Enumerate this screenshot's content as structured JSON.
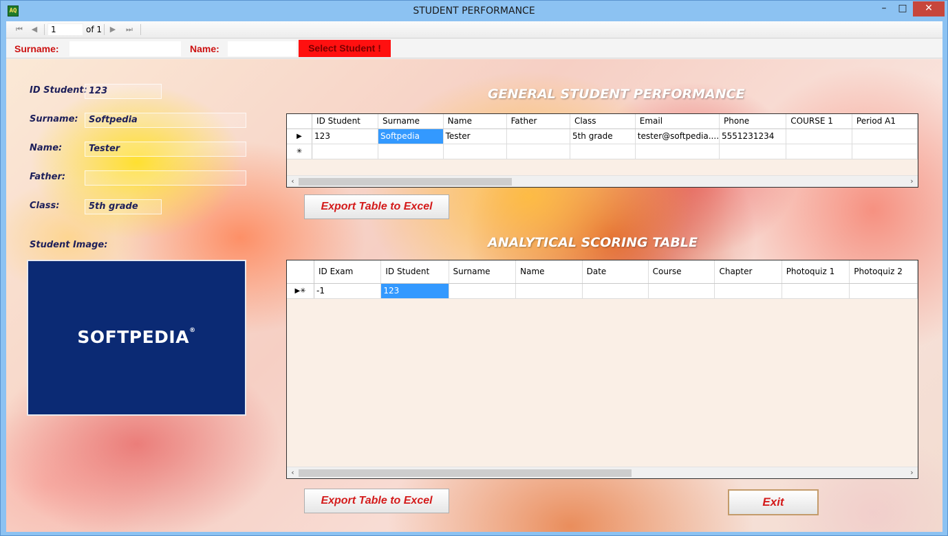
{
  "window": {
    "title": "STUDENT PERFORMANCE",
    "icon": "app-icon",
    "icon_glyph": "AQ",
    "controls": {
      "minimize": "–",
      "maximize": "□",
      "close": "✕"
    }
  },
  "navigator": {
    "position": "1",
    "of_label": "of 1",
    "first_icon": "⏮",
    "prev_icon": "◀",
    "next_icon": "▶",
    "last_icon": "⏭"
  },
  "filter": {
    "surname_label": "Surname:",
    "surname_value": "",
    "name_label": "Name:",
    "name_value": "",
    "select_button": "Select Student !"
  },
  "student": {
    "id_label": "ID Student:",
    "id_value": "123",
    "surname_label": "Surname:",
    "surname_value": "Softpedia",
    "name_label": "Name:",
    "name_value": "Tester",
    "father_label": "Father:",
    "father_value": "",
    "class_label": "Class:",
    "class_value": "5th grade",
    "image_label": "Student Image:",
    "image_logo_text": "SOFTPEDIA",
    "image_logo_mark": "®"
  },
  "general_table": {
    "title": "GENERAL STUDENT PERFORMANCE",
    "columns": [
      "ID Student",
      "Surname",
      "Name",
      "Father",
      "Class",
      "Email",
      "Phone",
      "COURSE 1",
      "Period A1"
    ],
    "rows": [
      {
        "indicator": "▶",
        "cells": [
          "123",
          "Softpedia",
          "Tester",
          "",
          "5th grade",
          "tester@softpedia....",
          "5551231234",
          "",
          ""
        ]
      },
      {
        "indicator": "✳",
        "cells": [
          "",
          "",
          "",
          "",
          "",
          "",
          "",
          "",
          ""
        ]
      }
    ],
    "scroll_left": "‹",
    "scroll_right": "›",
    "export_button": "Export Table to Excel"
  },
  "analytical_table": {
    "title": "ANALYTICAL SCORING TABLE",
    "columns": [
      "ID Exam",
      "ID Student",
      "Surname",
      "Name",
      "Date",
      "Course",
      "Chapter",
      "Photoquiz 1",
      "Photoquiz 2"
    ],
    "rows": [
      {
        "indicator": "▶✳",
        "cells": [
          "-1",
          "123",
          "",
          "",
          "",
          "",
          "",
          "",
          ""
        ]
      }
    ],
    "scroll_left": "‹",
    "scroll_right": "›",
    "export_button": "Export Table to Excel"
  },
  "exit_button": "Exit",
  "colors": {
    "accent_red": "#d41b1b",
    "select_bg": "#ff1010",
    "selection_blue": "#3399ff",
    "student_image_bg": "#0b2a74",
    "label_navy": "#1d1f5a"
  }
}
